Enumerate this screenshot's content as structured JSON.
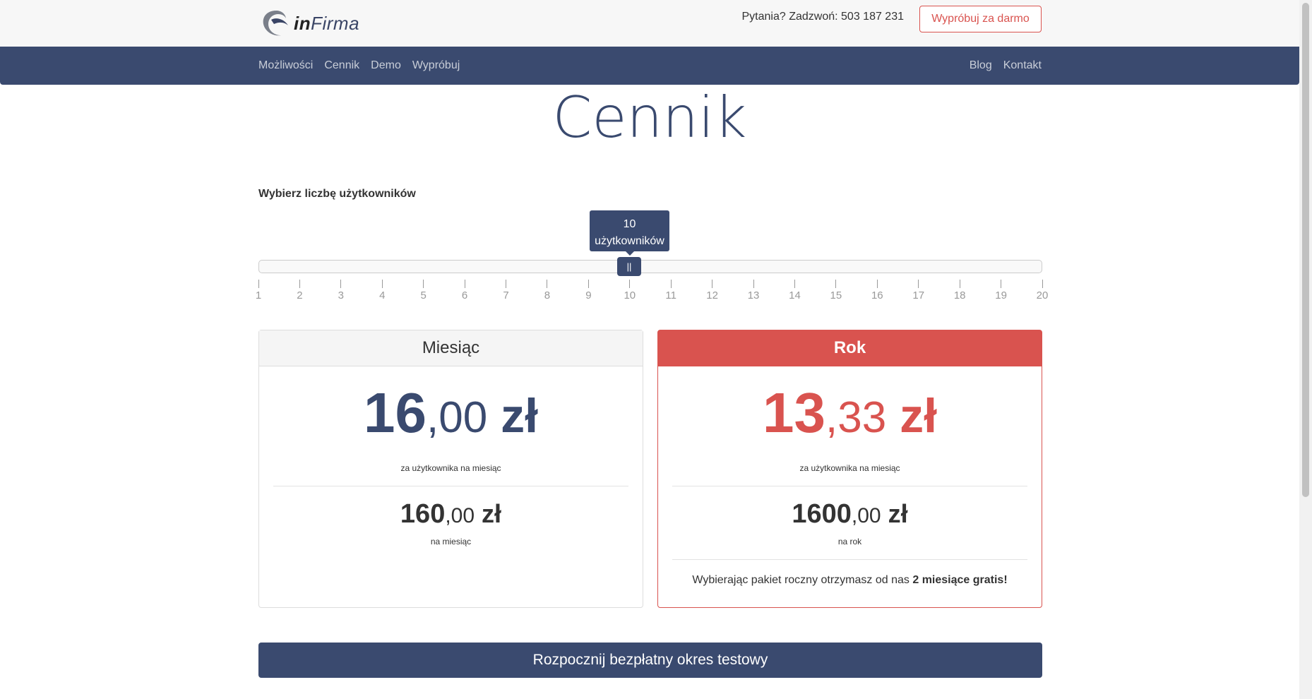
{
  "header": {
    "logo_text_bold": "in",
    "logo_text_rest": "Firma",
    "phone": "Pytania? Zadzwoń: 503 187 231",
    "try_button": "Wypróbuj za darmo"
  },
  "nav": {
    "left": [
      "Możliwości",
      "Cennik",
      "Demo",
      "Wypróbuj"
    ],
    "right": [
      "Blog",
      "Kontakt"
    ]
  },
  "page": {
    "title": "Cennik",
    "chooser_label": "Wybierz liczbę użytkowników"
  },
  "slider": {
    "value": 10,
    "tooltip_number": "10",
    "tooltip_unit": "użytkowników",
    "handle_glyph": "||",
    "min": 1,
    "max": 20,
    "ticks": [
      "1",
      "2",
      "3",
      "4",
      "5",
      "6",
      "7",
      "8",
      "9",
      "10",
      "11",
      "12",
      "13",
      "14",
      "15",
      "16",
      "17",
      "18",
      "19",
      "20"
    ]
  },
  "month_panel": {
    "title": "Miesiąc",
    "unit_int": "16",
    "unit_dec": ",00",
    "unit_cur": " zł",
    "unit_caption": "za użytkownika na miesiąc",
    "total_int": "160",
    "total_dec": ",00",
    "total_cur": " zł",
    "total_caption": "na miesiąc"
  },
  "year_panel": {
    "title": "Rok",
    "unit_int": "13",
    "unit_dec": ",33",
    "unit_cur": " zł",
    "unit_caption": "za użytkownika na miesiąc",
    "total_int": "1600",
    "total_dec": ",00",
    "total_cur": " zł",
    "total_caption": "na rok",
    "promo_text": "Wybierając pakiet roczny otrzymasz od nas ",
    "promo_bold": "2 miesiące gratis!"
  },
  "cta": {
    "label": "Rozpocznij bezpłatny okres testowy"
  },
  "colors": {
    "primary": "#3a4a6f",
    "accent": "#d9534f"
  }
}
